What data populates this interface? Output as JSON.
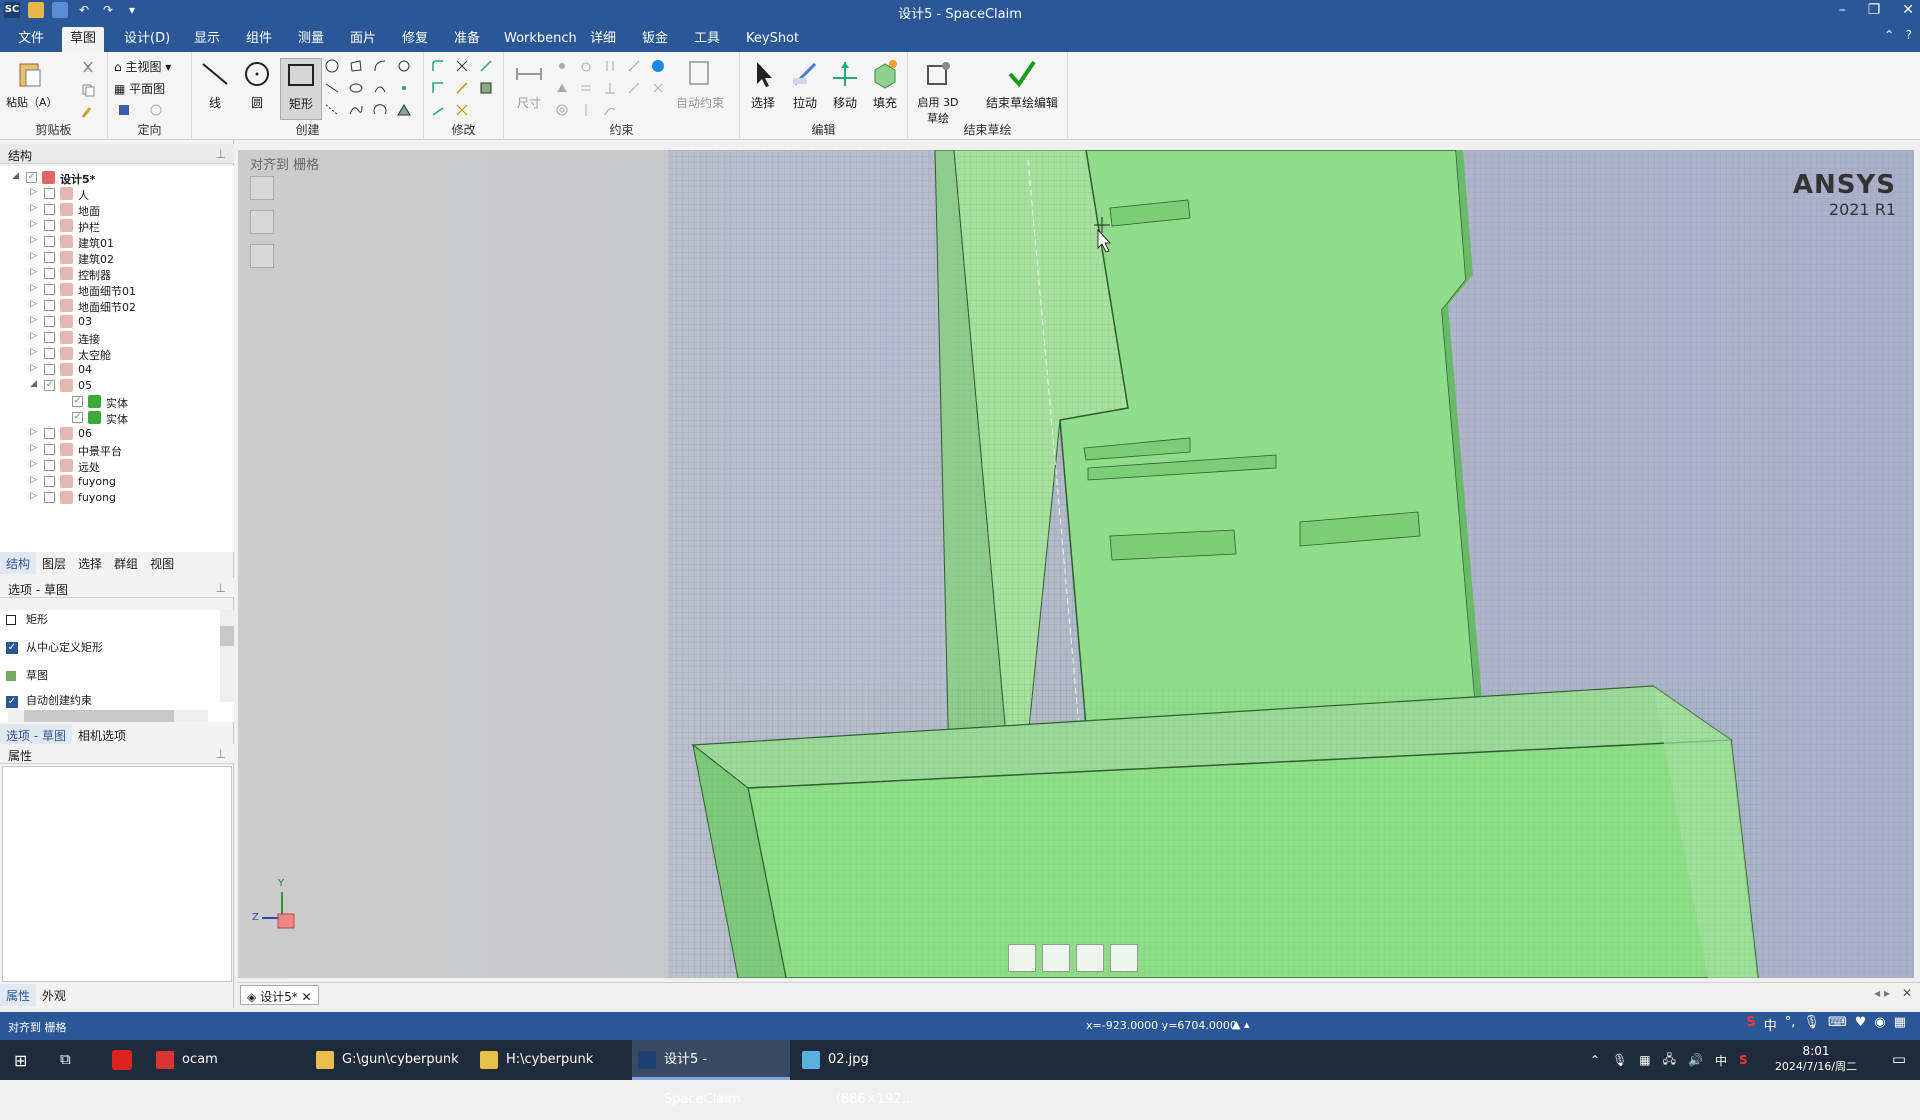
{
  "window": {
    "title": "设计5 - SpaceClaim"
  },
  "tabs": [
    "文件",
    "草图",
    "设计(D)",
    "显示",
    "组件",
    "测量",
    "面片",
    "修复",
    "准备",
    "Workbench",
    "详细",
    "钣金",
    "工具",
    "KeyShot"
  ],
  "ribbon": {
    "clipboard": {
      "paste": "粘贴（A）",
      "label": "剪贴板"
    },
    "orient": {
      "home": "主视图",
      "plan": "平面图",
      "label": "定向"
    },
    "create": {
      "line": "线",
      "circle": "圆",
      "rect": "矩形",
      "label": "创建"
    },
    "modify": {
      "label": "修改"
    },
    "constrain": {
      "dim": "尺寸",
      "auto": "自动约束",
      "label": "约束"
    },
    "edit": {
      "select": "选择",
      "pull": "拉动",
      "move": "移动",
      "fill": "填充",
      "label": "编辑"
    },
    "endsketch": {
      "enable3d": "启用 3D 草绘",
      "finish": "结束草绘编辑",
      "label": "结束草绘"
    }
  },
  "structure": {
    "title": "结构",
    "items": [
      {
        "label": "设计5*",
        "level": 0,
        "expanded": true,
        "checked": true,
        "bold": true
      },
      {
        "label": "人",
        "level": 1
      },
      {
        "label": "地面",
        "level": 1
      },
      {
        "label": "护栏",
        "level": 1
      },
      {
        "label": "建筑01",
        "level": 1
      },
      {
        "label": "建筑02",
        "level": 1
      },
      {
        "label": "控制器",
        "level": 1
      },
      {
        "label": "地面细节01",
        "level": 1
      },
      {
        "label": "地面细节02",
        "level": 1
      },
      {
        "label": "03",
        "level": 1
      },
      {
        "label": "连接",
        "level": 1
      },
      {
        "label": "太空舱",
        "level": 1
      },
      {
        "label": "04",
        "level": 1
      },
      {
        "label": "05",
        "level": 1,
        "expanded": true,
        "checked": true
      },
      {
        "label": "实体",
        "level": 2,
        "checked": true,
        "solid": true
      },
      {
        "label": "实体",
        "level": 2,
        "checked": true,
        "solid": true
      },
      {
        "label": "06",
        "level": 1
      },
      {
        "label": "中景平台",
        "level": 1
      },
      {
        "label": "远处",
        "level": 1
      },
      {
        "label": "fuyong",
        "level": 1
      },
      {
        "label": "fuyong",
        "level": 1
      }
    ],
    "tabs": [
      "结构",
      "图层",
      "选择",
      "群组",
      "视图"
    ]
  },
  "options": {
    "title": "选项 - 草图",
    "rows": [
      {
        "label": "矩形",
        "type": "header"
      },
      {
        "label": "从中心定义矩形",
        "type": "check",
        "checked": true
      },
      {
        "label": "草图",
        "type": "header"
      },
      {
        "label": "自动创建约束",
        "type": "check",
        "checked": true
      }
    ],
    "tabs": [
      "选项 - 草图",
      "相机选项"
    ]
  },
  "properties": {
    "title": "属性",
    "tabs": [
      "属性",
      "外观"
    ]
  },
  "viewport": {
    "snap_hint": "对齐到 栅格",
    "brand": "ANSYS",
    "version": "2021 R1",
    "axes": {
      "y": "Y",
      "z": "Z"
    }
  },
  "doc_tab": "设计5*",
  "status": {
    "left": "对齐到 栅格",
    "coords": "x=-923.0000  y=6704.0000"
  },
  "taskbar": {
    "items": [
      "ocam",
      "G:\\gun\\cyberpunk",
      "H:\\cyberpunk",
      "设计5 - SpaceClaim",
      "02.jpg（886×192..."
    ],
    "time": "8:01",
    "date": "2024/7/16/周二",
    "ime": "中"
  }
}
